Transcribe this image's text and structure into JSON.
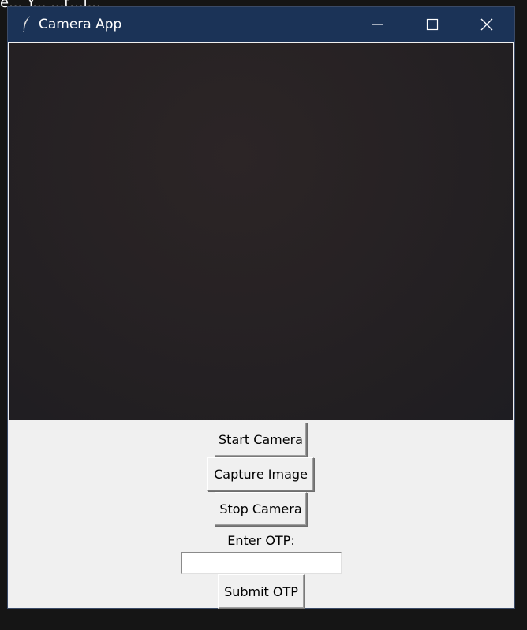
{
  "background": {
    "partial_text": "e... Y... ...t...i..."
  },
  "window": {
    "title": "Camera App",
    "icon": "feather-icon",
    "controls": {
      "minimize": "minimize-icon",
      "maximize": "maximize-icon",
      "close": "close-icon"
    }
  },
  "camera_feed": {
    "state": "live dark frame"
  },
  "buttons": {
    "start_camera": "Start Camera",
    "capture_image": "Capture Image",
    "stop_camera": "Stop Camera",
    "submit_otp": "Submit OTP"
  },
  "otp": {
    "label": "Enter OTP:",
    "value": "",
    "placeholder": ""
  },
  "colors": {
    "titlebar": "#1b3357",
    "window_bg": "#f0f0f0",
    "desktop_bg": "#151515"
  }
}
